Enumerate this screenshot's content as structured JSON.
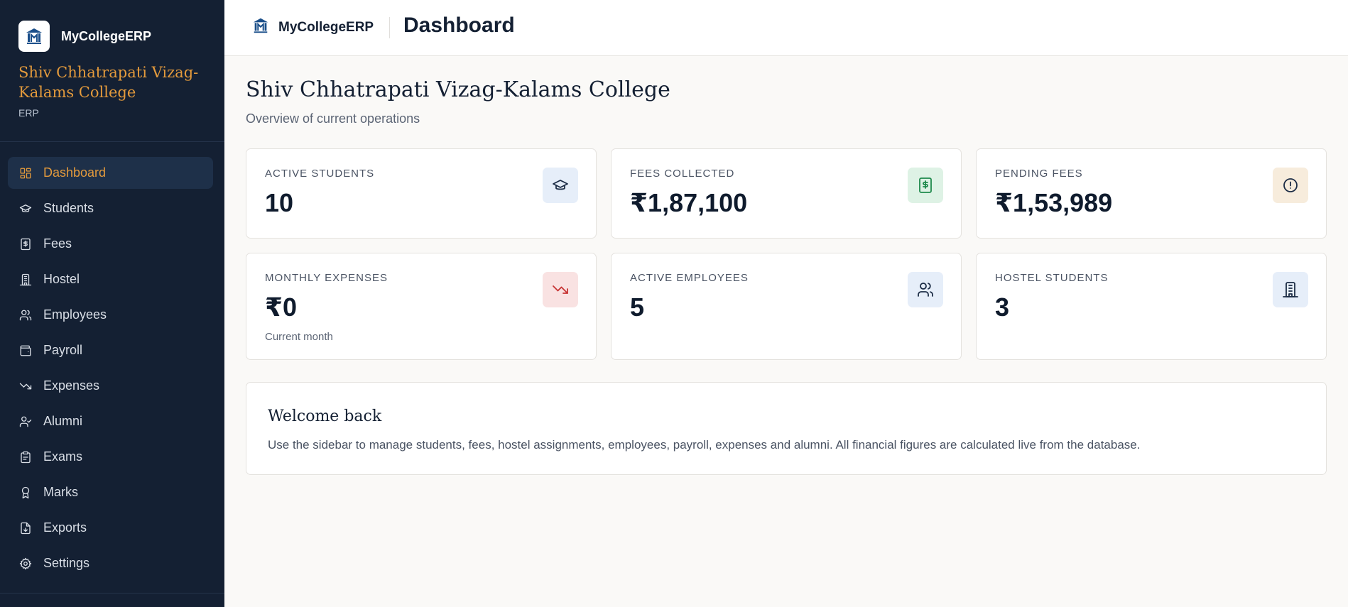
{
  "sidebar": {
    "brand": "MyCollegeERP",
    "college_name": "Shiv Chhatrapati Vizag-Kalams College",
    "college_sub": "ERP",
    "items": [
      {
        "label": "Dashboard",
        "icon": "dashboard-icon"
      },
      {
        "label": "Students",
        "icon": "graduation-cap-icon"
      },
      {
        "label": "Fees",
        "icon": "receipt-icon"
      },
      {
        "label": "Hostel",
        "icon": "building-icon"
      },
      {
        "label": "Employees",
        "icon": "users-icon"
      },
      {
        "label": "Payroll",
        "icon": "wallet-icon"
      },
      {
        "label": "Expenses",
        "icon": "trending-down-icon"
      },
      {
        "label": "Alumni",
        "icon": "user-check-icon"
      },
      {
        "label": "Exams",
        "icon": "clipboard-icon"
      },
      {
        "label": "Marks",
        "icon": "award-icon"
      },
      {
        "label": "Exports",
        "icon": "file-download-icon"
      },
      {
        "label": "Settings",
        "icon": "gear-icon"
      }
    ]
  },
  "topbar": {
    "brand": "MyCollegeERP",
    "title": "Dashboard"
  },
  "main": {
    "title": "Shiv Chhatrapati Vizag-Kalams College",
    "subtitle": "Overview of current operations",
    "stats": [
      {
        "label": "ACTIVE STUDENTS",
        "value": "10",
        "icon": "graduation-cap-icon"
      },
      {
        "label": "FEES COLLECTED",
        "value": "₹1,87,100",
        "icon": "receipt-icon"
      },
      {
        "label": "PENDING FEES",
        "value": "₹1,53,989",
        "icon": "alert-circle-icon"
      },
      {
        "label": "MONTHLY EXPENSES",
        "value": "₹0",
        "note": "Current month",
        "icon": "trending-down-icon"
      },
      {
        "label": "ACTIVE EMPLOYEES",
        "value": "5",
        "icon": "users-icon"
      },
      {
        "label": "HOSTEL STUDENTS",
        "value": "3",
        "icon": "building-icon"
      }
    ],
    "welcome": {
      "title": "Welcome back",
      "text": "Use the sidebar to manage students, fees, hostel assignments, employees, payroll, expenses and alumni. All financial figures are calculated live from the database."
    }
  },
  "colors": {
    "sidebar_bg": "#142033",
    "accent": "#e39a3c",
    "page_bg": "#faf9f7"
  }
}
